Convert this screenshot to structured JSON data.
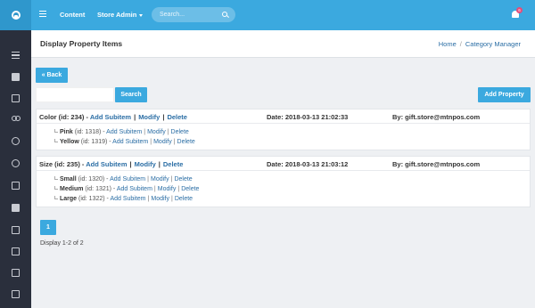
{
  "topbar": {
    "nav_content": "Content",
    "nav_store_admin": "Store Admin",
    "search_placeholder": "Search...",
    "notification_count": "6"
  },
  "page": {
    "title": "Display Property Items",
    "breadcrumb": [
      "Home",
      "Category Manager"
    ]
  },
  "actions": {
    "back": "« Back",
    "search": "Search",
    "add_property": "Add Property"
  },
  "properties": [
    {
      "name_label": "Color (id: 234) -",
      "add_subitem": "Add Subitem",
      "modify": "Modify",
      "delete": "Delete",
      "date": "Date: 2018-03-13 21:02:33",
      "by": "By: gift.store@mtnpos.com",
      "subitems": [
        {
          "name": "Pink",
          "id": "(id: 1318) -",
          "add": "Add Subitem",
          "modify": "Modify",
          "delete": "Delete"
        },
        {
          "name": "Yellow",
          "id": "(id: 1319) -",
          "add": "Add Subitem",
          "modify": "Modify",
          "delete": "Delete"
        }
      ]
    },
    {
      "name_label": "Size (id: 235) -",
      "add_subitem": "Add Subitem",
      "modify": "Modify",
      "delete": "Delete",
      "date": "Date: 2018-03-13 21:03:12",
      "by": "By: gift.store@mtnpos.com",
      "subitems": [
        {
          "name": "Small",
          "id": "(id: 1320) -",
          "add": "Add Subitem",
          "modify": "Modify",
          "delete": "Delete"
        },
        {
          "name": "Medium",
          "id": "(id: 1321) -",
          "add": "Add Subitem",
          "modify": "Modify",
          "delete": "Delete"
        },
        {
          "name": "Large",
          "id": "(id: 1322) -",
          "add": "Add Subitem",
          "modify": "Modify",
          "delete": "Delete"
        }
      ]
    }
  ],
  "pagination": {
    "current_page": "1",
    "display_text": "Display 1-2 of 2"
  },
  "sidebar_icons": [
    "list-icon",
    "briefcase-icon",
    "expand-icon",
    "users-icon",
    "globe-icon",
    "clock-icon",
    "expand-icon",
    "mail-icon",
    "expand-icon",
    "images-icon",
    "images-icon",
    "expand-icon"
  ],
  "colors": {
    "primary": "#3ba9df",
    "sidebar": "#2a2f3c",
    "link": "#2b6ea5",
    "badge": "#e54d7a"
  }
}
